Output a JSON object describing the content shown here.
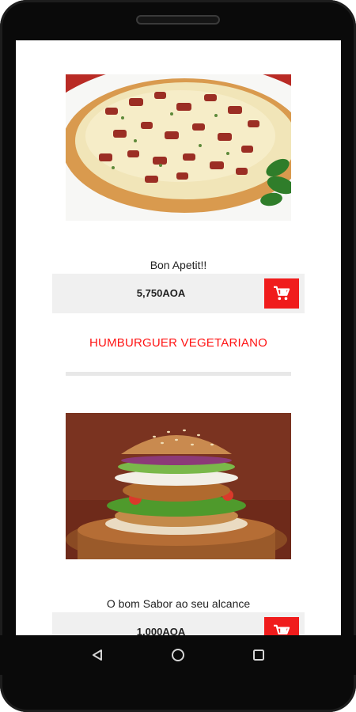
{
  "items": [
    {
      "image_icon": "pizza-photo",
      "caption": "Bon Apetit!!",
      "price": "5,750AOA",
      "cart_icon": "shopping-cart-icon"
    },
    {
      "title": "HUMBURGUER VEGETARIANO",
      "image_icon": "veggie-burger-photo",
      "caption": "O bom Sabor ao seu alcance",
      "price": "1,000AOA",
      "cart_icon": "shopping-cart-icon"
    }
  ],
  "colors": {
    "accent": "#f01c1c",
    "title": "#ff1414",
    "price_bg": "#f0f0f0"
  },
  "nav": {
    "back_icon": "back-triangle-icon",
    "home_icon": "home-circle-icon",
    "recents_icon": "recents-square-icon"
  }
}
